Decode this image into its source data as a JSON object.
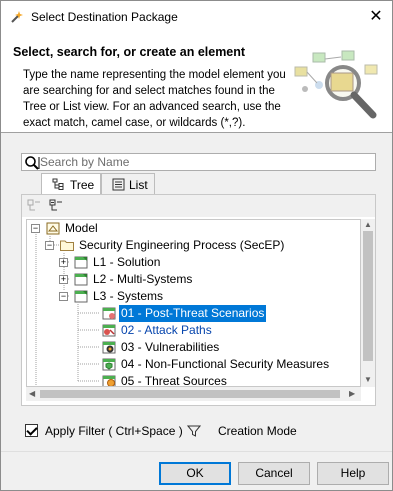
{
  "window": {
    "title": "Select Destination Package"
  },
  "header": {
    "title": "Select, search for, or create an element",
    "description": "Type the name representing the model element you are searching for and select matches found in the Tree or List view. For an advanced search, use the exact match, camel case, or wildcards (*,?)."
  },
  "search": {
    "placeholder": "Search by Name",
    "value": ""
  },
  "tabs": [
    {
      "label": "Tree",
      "active": true,
      "icon": "tree-icon"
    },
    {
      "label": "List",
      "active": false,
      "icon": "list-icon"
    }
  ],
  "tree": {
    "nodes": [
      {
        "label": "Model",
        "icon": "model-icon",
        "expanded": true
      },
      {
        "label": "Security Engineering Process (SecEP)",
        "icon": "folder-icon",
        "expanded": true
      },
      {
        "label": "L1 - Solution",
        "icon": "package-icon",
        "expanded": false
      },
      {
        "label": "L2 - Multi-Systems",
        "icon": "package-icon",
        "expanded": false
      },
      {
        "label": "L3 - Systems",
        "icon": "package-icon",
        "expanded": true
      },
      {
        "label": "01 - Post-Threat Scenarios",
        "icon": "package-icon",
        "selected": true
      },
      {
        "label": "02 - Attack Paths",
        "icon": "package-icon",
        "linked": true
      },
      {
        "label": "03 - Vulnerabilities",
        "icon": "package-icon"
      },
      {
        "label": "04 - Non-Functional Security Measures",
        "icon": "package-icon"
      },
      {
        "label": "05 - Threat Sources",
        "icon": "package-icon"
      }
    ]
  },
  "options": {
    "apply_filter_label": "Apply Filter ( Ctrl+Space )",
    "apply_filter_checked": true,
    "creation_mode_label": "Creation Mode"
  },
  "buttons": {
    "ok": "OK",
    "cancel": "Cancel",
    "help": "Help"
  },
  "colors": {
    "selection": "#0078d7",
    "link": "#0645ad",
    "accent_package": "#4caf50"
  }
}
